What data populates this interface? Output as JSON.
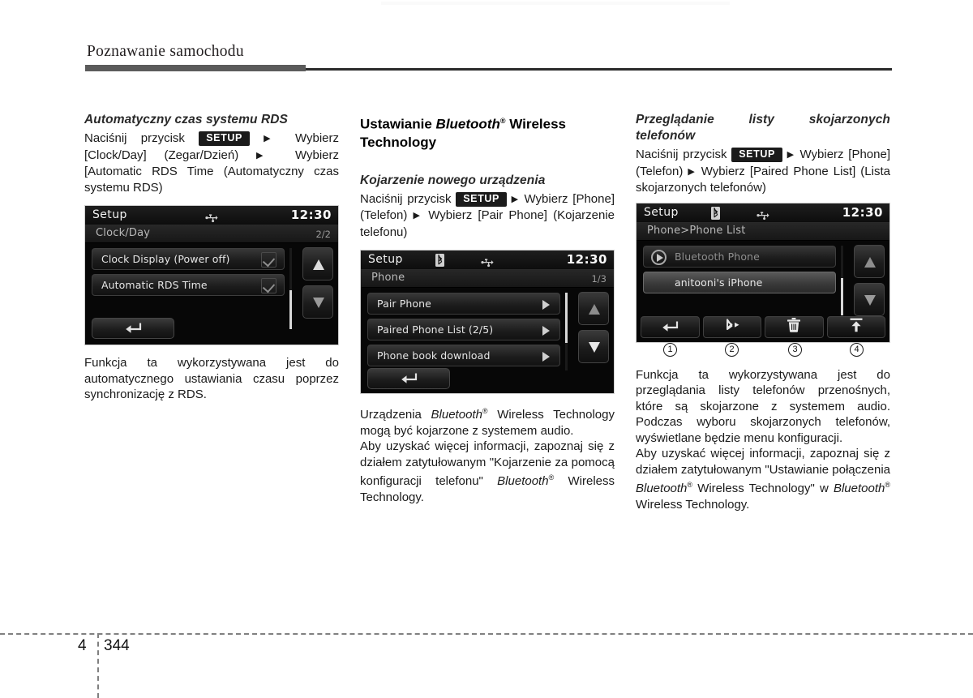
{
  "page": {
    "chapter_title": "Poznawanie samochodu",
    "chapter_number": "4",
    "page_number": "344"
  },
  "column_1": {
    "section_title": "Automatyczny czas systemu RDS",
    "instruction_parts": {
      "p1": "Naciśnij  przycisk",
      "keycap": "SETUP",
      "p2": "Wybierz [Clock/Day]  (Zegar/Dzień)",
      "p3": "Wybierz [Automatic  RDS Time  (Automatyczny czas systemu RDS)"
    },
    "caption": "Funkcja  ta  wykorzystywana  jest  do automatycznego    ustawiania    czasu poprzez synchronizację z RDS.",
    "device": {
      "title": "Setup",
      "clock": "12:30",
      "icons": [
        "usb-icon"
      ],
      "subtitle": "Clock/Day",
      "page_indicator": "2/2",
      "rows": [
        {
          "label": "Clock Display (Power off)",
          "checked": true
        },
        {
          "label": "Automatic RDS Time",
          "checked": true
        }
      ],
      "back_button": "back-icon",
      "nav_up": "scroll-up-icon",
      "nav_down": "scroll-down-icon"
    }
  },
  "column_2": {
    "heading_parts": {
      "a": "Ustawianie ",
      "b": "Bluetooth",
      "c": "®",
      "d": " Wireless Technology"
    },
    "section_title": "Kojarzenie nowego urządzenia",
    "instruction_parts": {
      "p1": "Naciśnij  przycisk",
      "keycap": "SETUP",
      "p2": "Wybierz [Phone] (Telefon)",
      "p3": "Wybierz [Pair Phone] (Kojarzenie telefonu)"
    },
    "device": {
      "title": "Setup",
      "clock": "12:30",
      "icons": [
        "bluetooth-icon",
        "usb-icon"
      ],
      "subtitle": "Phone",
      "page_indicator": "1/3",
      "rows": [
        {
          "label": "Pair Phone",
          "arrow": true
        },
        {
          "label": "Paired Phone List  (2/5)",
          "arrow": true
        },
        {
          "label": "Phone book download",
          "arrow": true
        }
      ],
      "back_button": "back-icon",
      "nav_up": "scroll-up-icon",
      "nav_down": "scroll-down-icon"
    },
    "caption_1_parts": {
      "a": "Urządzenia         ",
      "b": "Bluetooth",
      "c": "®",
      "d": "       Wireless Technology  mogą  być  kojarzone  z systemem audio."
    },
    "caption_2_parts": {
      "a": "Aby uzyskać więcej informacji, zapoznaj się z działem zatytułowanym \"Kojarzenie za     pomocą     konfiguracji     telefonu\" ",
      "b": "Bluetooth",
      "c": "®",
      "d": " Wireless Technology."
    }
  },
  "column_3": {
    "section_title": "Przeglądanie     listy     skojarzonych telefonów",
    "instruction_parts": {
      "p1": "Naciśnij  przycisk",
      "keycap": "SETUP",
      "p2": "Wybierz [Phone] (Telefon)",
      "p3": "Wybierz [Paired Phone  List]  (Lista  skojarzonych telefonów)"
    },
    "device": {
      "title": "Setup",
      "clock": "12:30",
      "icons": [
        "bluetooth-icon",
        "usb-icon"
      ],
      "subtitle": "Phone>Phone List",
      "page_indicator": "",
      "rows": [
        {
          "label": "Bluetooth Phone",
          "dim": true,
          "play": true
        },
        {
          "label": "anitooni's iPhone",
          "selected": true
        }
      ],
      "toolbar": [
        {
          "icon": "back-icon",
          "callout": "1"
        },
        {
          "icon": "bluetooth-connect-icon",
          "callout": "2"
        },
        {
          "icon": "trash-icon",
          "callout": "3"
        },
        {
          "icon": "move-to-top-icon",
          "callout": "4"
        }
      ],
      "nav_up": "scroll-up-icon",
      "nav_down": "scroll-down-icon"
    },
    "caption_1": "Funkcja  ta  wykorzystywana  jest  do przeglądania         listy         telefonów przenośnych,  które  są  skojarzone  z systemem  audio.  Podczas  wyboru skojarzonych  telefonów,  wyświetlane będzie menu konfiguracji.",
    "caption_2_parts": {
      "a": "Aby uzyskać więcej informacji, zapoznaj się z działem zatytułowanym \"Ustawianie połączenia      ",
      "b": "Bluetooth",
      "c": "®",
      "d": "      Wireless Technology\"  w  ",
      "e": "Bluetooth",
      "f": "®",
      "g": "  Wireless Technology."
    }
  },
  "colors": {
    "rule_thick": "#5b5b5b",
    "rule_thin": "#2b2b2b",
    "keycap_bg": "#1b1b1b",
    "device_bg": "#0a0a0a"
  }
}
